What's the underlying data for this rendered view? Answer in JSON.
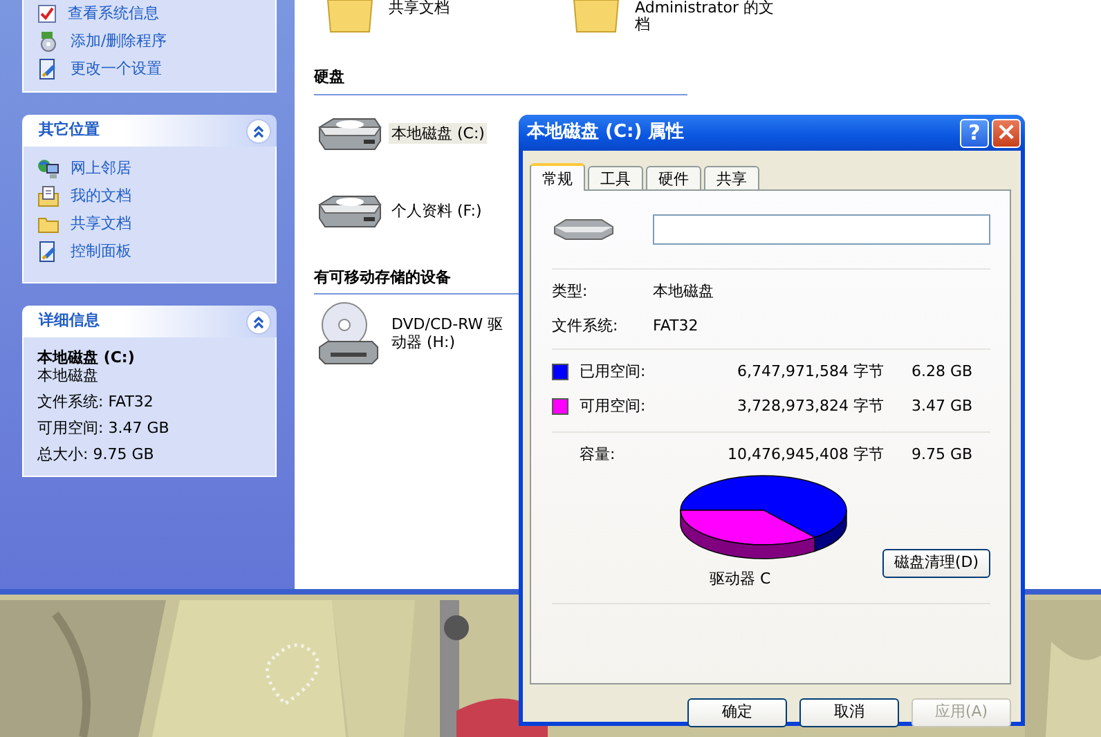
{
  "sidebar": {
    "tasks": [
      {
        "kind": "sysinfo",
        "label": "查看系统信息"
      },
      {
        "kind": "programs",
        "label": "添加/删除程序"
      },
      {
        "kind": "settings",
        "label": "更改一个设置"
      }
    ],
    "other_places": {
      "title": "其它位置",
      "expanded": true,
      "items": [
        {
          "kind": "network",
          "label": "网上邻居"
        },
        {
          "kind": "documents",
          "label": "我的文档"
        },
        {
          "kind": "folder",
          "label": "共享文档"
        },
        {
          "kind": "settings",
          "label": "控制面板"
        }
      ]
    },
    "details": {
      "title": "详细信息",
      "expanded": true,
      "name": "本地磁盘 (C:)",
      "type": "本地磁盘",
      "lines": [
        "文件系统: FAT32",
        "可用空间: 3.47 GB",
        "总大小: 9.75 GB"
      ]
    }
  },
  "content": {
    "top_items": [
      {
        "kind": "folder",
        "label": "共享文档"
      },
      {
        "kind": "folder",
        "label": "Administrator 的文档"
      }
    ],
    "sections": [
      {
        "title": "硬盘",
        "items": [
          {
            "kind": "hdd",
            "label": "本地磁盘 (C:)",
            "selected": true
          },
          {
            "kind": "hdd",
            "label": "个人资料 (F:)",
            "selected": false
          }
        ]
      },
      {
        "title": "有可移动存储的设备",
        "items": [
          {
            "kind": "cdrom",
            "label": "DVD/CD-RW 驱动器 (H:)",
            "selected": false
          }
        ]
      }
    ]
  },
  "dialog": {
    "title": "本地磁盘 (C:) 属性",
    "help": "?",
    "close": "×",
    "tabs": [
      {
        "label": "常规",
        "selected": true
      },
      {
        "label": "工具",
        "selected": false
      },
      {
        "label": "硬件",
        "selected": false
      },
      {
        "label": "共享",
        "selected": false
      }
    ],
    "info": [
      {
        "label": "类型:",
        "value": "本地磁盘"
      },
      {
        "label": "文件系统:",
        "value": "FAT32"
      }
    ],
    "usage": [
      {
        "label": "已用空间:",
        "bytes": "6,747,971,584 字节",
        "size": "6.28 GB",
        "color": "#0000ff"
      },
      {
        "label": "可用空间:",
        "bytes": "3,728,973,824 字节",
        "size": "3.47 GB",
        "color": "#ff00ff"
      }
    ],
    "capacity": {
      "label": "容量:",
      "bytes": "10,476,945,408 字节",
      "size": "9.75 GB"
    },
    "drive_label": "驱动器 C",
    "cleanup_button": "磁盘清理(D)",
    "buttons": [
      {
        "label": "确定",
        "disabled": false
      },
      {
        "label": "取消",
        "disabled": false
      },
      {
        "label": "应用(A)",
        "disabled": true
      }
    ]
  }
}
